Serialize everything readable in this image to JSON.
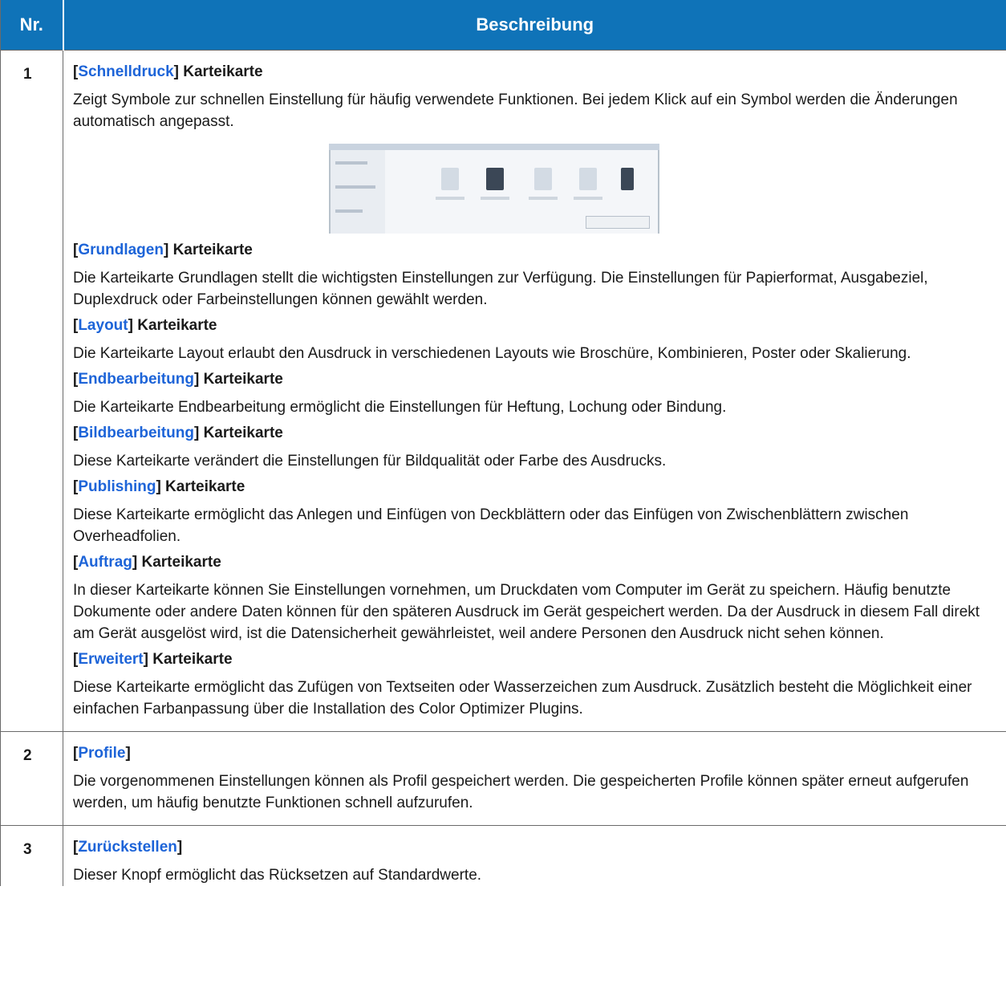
{
  "header": {
    "col_nr": "Nr.",
    "col_desc": "Beschreibung"
  },
  "rows": [
    {
      "nr": "1",
      "sections": [
        {
          "link": "Schnelldruck",
          "suffix": "Karteikarte",
          "text": "Zeigt Symbole zur schnellen Einstellung für häufig verwendete Funktionen. Bei jedem Klick auf ein Symbol werden die Änderungen automatisch angepasst."
        },
        {
          "link": "Grundlagen",
          "suffix": "Karteikarte",
          "text": "Die Karteikarte Grundlagen stellt die wichtigsten Einstellungen zur Verfügung. Die Einstellungen für Papierformat, Ausgabeziel, Duplexdruck oder Farbeinstellungen können gewählt werden."
        },
        {
          "link": "Layout",
          "suffix": "Karteikarte",
          "text": "Die Karteikarte Layout erlaubt den Ausdruck in verschiedenen Layouts wie Broschüre, Kombinieren, Poster oder Skalierung."
        },
        {
          "link": "Endbearbeitung",
          "suffix": "Karteikarte",
          "text": "Die Karteikarte Endbearbeitung ermöglicht die Einstellungen für Heftung, Lochung oder Bindung."
        },
        {
          "link": "Bildbearbeitung",
          "suffix": "Karteikarte",
          "text": "Diese Karteikarte verändert die Einstellungen für Bildqualität oder Farbe des Ausdrucks."
        },
        {
          "link": "Publishing",
          "suffix": "Karteikarte",
          "text": "Diese Karteikarte ermöglicht das Anlegen und Einfügen von Deckblättern oder das Einfügen von Zwischenblättern zwischen Overheadfolien."
        },
        {
          "link": "Auftrag",
          "suffix": "Karteikarte",
          "text": "In dieser Karteikarte können Sie Einstellungen vornehmen, um Druckdaten vom Computer im Gerät zu speichern. Häufig benutzte Dokumente oder andere Daten können für den späteren Ausdruck im Gerät gespeichert werden. Da der Ausdruck in diesem Fall direkt am Gerät ausgelöst wird, ist die Datensicherheit gewährleistet, weil andere Personen den Ausdruck nicht sehen können."
        },
        {
          "link": "Erweitert",
          "suffix": "Karteikarte",
          "text": "Diese Karteikarte ermöglicht das Zufügen von Textseiten oder Wasserzeichen zum Ausdruck. Zusätzlich besteht die Möglichkeit einer einfachen Farbanpassung über die Installation des Color Optimizer Plugins."
        }
      ]
    },
    {
      "nr": "2",
      "sections": [
        {
          "link": "Profile",
          "text": "Die vorgenommenen Einstellungen können als Profil gespeichert werden. Die gespeicherten Profile können später erneut aufgerufen werden, um häufig benutzte Funktionen schnell aufzurufen."
        }
      ]
    },
    {
      "nr": "3",
      "sections": [
        {
          "link": "Zurückstellen",
          "text": "Dieser Knopf ermöglicht das Rücksetzen auf Standardwerte."
        }
      ]
    }
  ],
  "colors": {
    "header_bg": "#0f73b8",
    "link": "#1d64d8",
    "rule": "#6a6a6a"
  }
}
